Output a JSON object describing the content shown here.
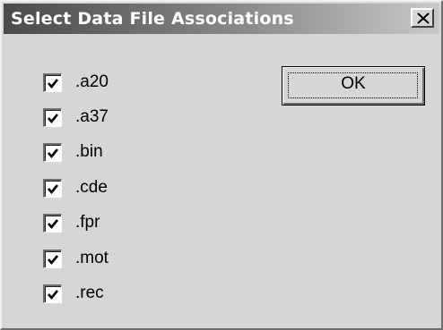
{
  "window": {
    "title": "Select Data File Associations"
  },
  "buttons": {
    "ok_label": "OK"
  },
  "associations": [
    {
      "label": ".a20",
      "checked": true
    },
    {
      "label": ".a37",
      "checked": true
    },
    {
      "label": ".bin",
      "checked": true
    },
    {
      "label": ".cde",
      "checked": true
    },
    {
      "label": ".fpr",
      "checked": true
    },
    {
      "label": ".mot",
      "checked": true
    },
    {
      "label": ".rec",
      "checked": true
    }
  ]
}
